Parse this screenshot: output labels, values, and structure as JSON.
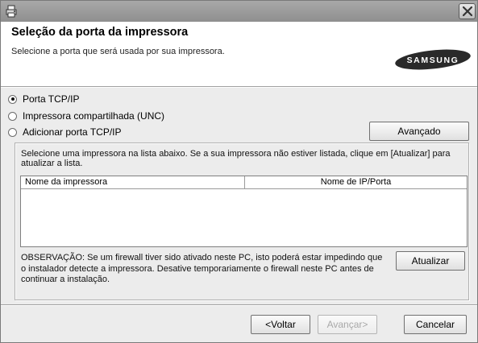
{
  "window": {
    "icons": {
      "app": "printer-setup-icon",
      "close": "close-icon"
    }
  },
  "header": {
    "title": "Seleção da porta da impressora",
    "subtitle": "Selecione a porta que será usada por sua impressora.",
    "logo_text": "SAMSUNG"
  },
  "port_options": [
    {
      "label": "Porta TCP/IP",
      "selected": true
    },
    {
      "label": "Impressora compartilhada (UNC)",
      "selected": false
    },
    {
      "label": "Adicionar porta TCP/IP",
      "selected": false
    }
  ],
  "advanced_button": "Avançado",
  "printer_list": {
    "instructions": "Selecione uma impressora na lista abaixo. Se a sua impressora não estiver listada, clique em [Atualizar] para atualizar a lista.",
    "columns": [
      "Nome da impressora",
      "Nome de IP/Porta"
    ],
    "rows": []
  },
  "note": "OBSERVAÇÃO: Se um firewall tiver sido ativado neste PC, isto poderá estar impedindo que o instalador detecte a impressora. Desative temporariamente o firewall neste PC antes de continuar a instalação.",
  "refresh_button": "Atualizar",
  "footer": {
    "back": "<Voltar",
    "next": "Avançar>",
    "next_enabled": false,
    "cancel": "Cancelar"
  }
}
